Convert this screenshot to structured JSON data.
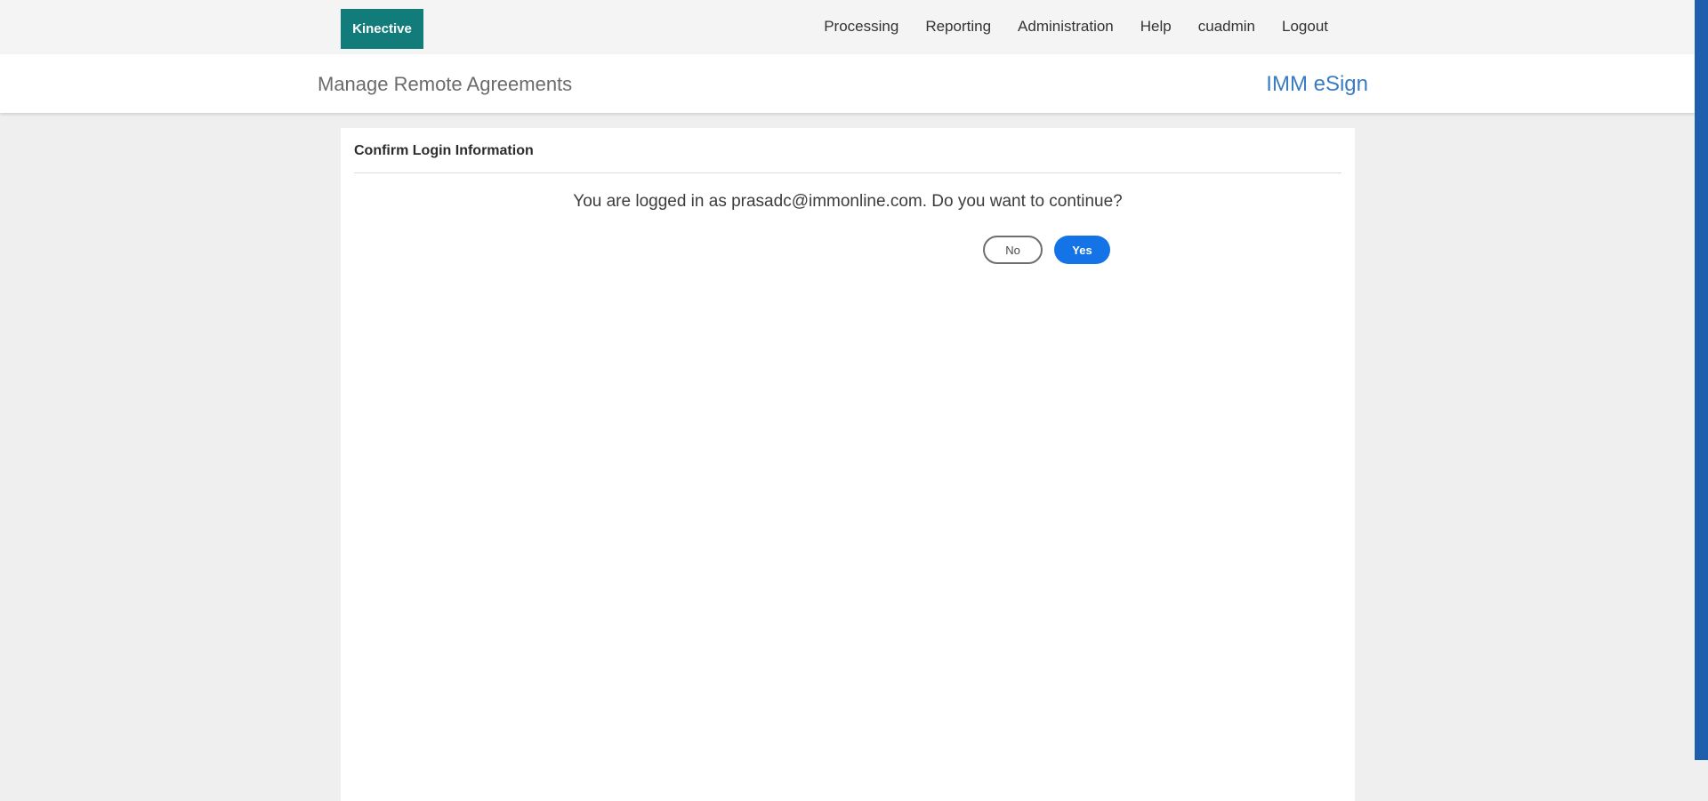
{
  "header": {
    "logo_text": "Kinective",
    "nav": [
      "Processing",
      "Reporting",
      "Administration",
      "Help",
      "cuadmin",
      "Logout"
    ]
  },
  "subheader": {
    "title": "Manage Remote Agreements",
    "app_name": "IMM eSign"
  },
  "dialog": {
    "title": "Confirm Login Information",
    "message": "You are logged in as prasadc@immonline.com. Do you want to continue?",
    "no_label": "No",
    "yes_label": "Yes"
  },
  "colors": {
    "brand_teal": "#127c7a",
    "link_blue": "#3a7cc4",
    "primary_button": "#1473e6",
    "scroll_strip": "#1d5fad"
  }
}
